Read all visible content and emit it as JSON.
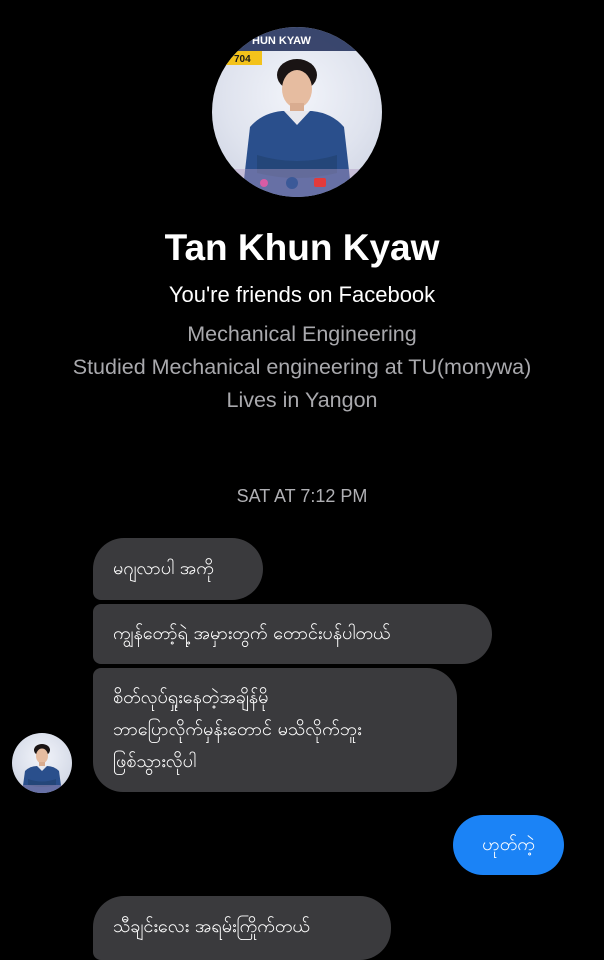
{
  "profile": {
    "name": "Tan Khun Kyaw",
    "friends_status": "You're friends on Facebook",
    "details": [
      "Mechanical Engineering",
      "Studied Mechanical engineering at TU(monywa)",
      "Lives in Yangon"
    ],
    "avatar_banner_text": "HUN KYAW",
    "avatar_badge_text": "704"
  },
  "conversation": {
    "timestamp": "SAT AT 7:12 PM",
    "messages": [
      {
        "from": "contact",
        "text": "မဂျလာပါ အကို"
      },
      {
        "from": "contact",
        "text": "ကျွန်တော့်ရဲ့ အမှားတွက် တောင်းပန်ပါတယ်"
      },
      {
        "from": "contact",
        "text": "စိတ်လုပ်ရှုးနေတဲ့အချိန်မို\nဘာပြောလိုက်မှန်းတောင် မသိလိုက်ဘူး\nဖြစ်သွားလိုပါ"
      },
      {
        "from": "me",
        "text": "ဟုတ်ကဲ့"
      },
      {
        "from": "contact",
        "text": "သီချင်းလေး အရမ်းကြိုက်တယ်"
      }
    ]
  },
  "colors": {
    "background": "#000000",
    "incoming_bubble": "#3a3a3d",
    "outgoing_bubble": "#1b83f6",
    "secondary_text": "#a9a9ad"
  }
}
